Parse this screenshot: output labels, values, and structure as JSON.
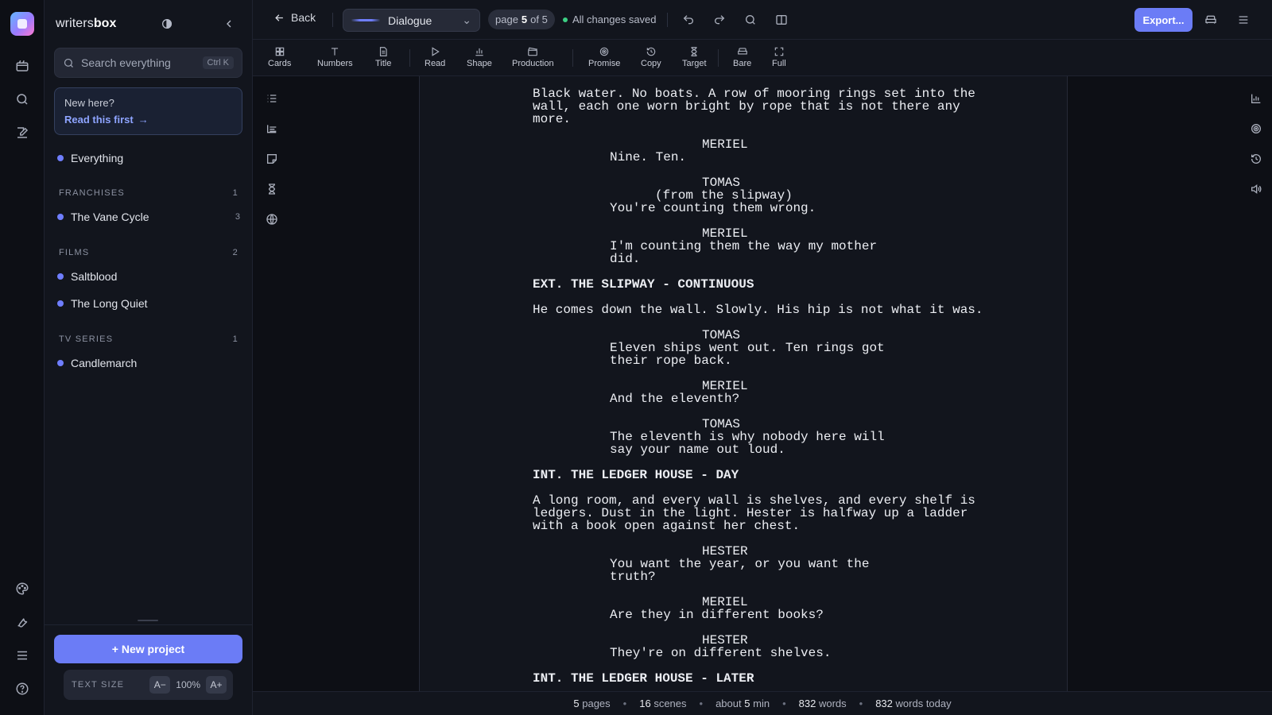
{
  "app": {
    "brand_light": "writers",
    "brand_bold": "box"
  },
  "sidebar": {
    "search_placeholder": "Search everything",
    "search_shortcut": "Ctrl K",
    "newhere_title": "New here?",
    "newhere_link": "Read this first",
    "everything": "Everything",
    "sections": [
      {
        "title": "FRANCHISES",
        "count": "1",
        "items": [
          {
            "label": "The Vane Cycle",
            "count": "3"
          }
        ]
      },
      {
        "title": "FILMS",
        "count": "2",
        "items": [
          {
            "label": "Saltblood"
          },
          {
            "label": "The Long Quiet"
          }
        ]
      },
      {
        "title": "TV SERIES",
        "count": "1",
        "items": [
          {
            "label": "Candlemarch"
          }
        ]
      }
    ],
    "new_project": "+ New project",
    "text_size_label": "TEXT SIZE",
    "text_size_minus": "A−",
    "text_size_value": "100%",
    "text_size_plus": "A+"
  },
  "topbar": {
    "back": "Back",
    "element_type": "Dialogue",
    "page_prefix": "page",
    "page_current": "5",
    "page_suffix": "of 5",
    "saved": "All changes saved",
    "export": "Export..."
  },
  "toolbar": {
    "tools": [
      "Cards",
      "Numbers",
      "Title",
      "Read",
      "Shape",
      "Production",
      "Promise",
      "Copy",
      "Target",
      "Bare",
      "Full"
    ]
  },
  "script": {
    "action1": "Black water. No boats. A row of mooring rings set into the wall, each one worn bright by rope that is not there any more.",
    "c1": "MERIEL",
    "d1": "Nine. Ten.",
    "c2": "TOMAS",
    "p2": "(from the slipway)",
    "d2": "You're counting them wrong.",
    "c3": "MERIEL",
    "d3": "I'm counting them the way my mother did.",
    "slug1": "EXT. THE SLIPWAY - CONTINUOUS",
    "action2": "He comes down the wall. Slowly. His hip is not what it was.",
    "c4": "TOMAS",
    "d4": "Eleven ships went out. Ten rings got their rope back.",
    "c5": "MERIEL",
    "d5": "And the eleventh?",
    "c6": "TOMAS",
    "d6": "The eleventh is why nobody here will say your name out loud.",
    "slug2": "INT. THE LEDGER HOUSE - DAY",
    "action3": "A long room, and every wall is shelves, and every shelf is ledgers. Dust in the light. Hester is halfway up a ladder with a book open against her chest.",
    "c7": "HESTER",
    "d7": "You want the year, or you want the truth?",
    "c8": "MERIEL",
    "d8": "Are they in different books?",
    "c9": "HESTER",
    "d9": "They're on different shelves.",
    "slug3": "INT. THE LEDGER HOUSE - LATER"
  },
  "status": {
    "pages_n": "5",
    "pages_l": "pages",
    "scenes_n": "16",
    "scenes_l": "scenes",
    "time_l": "about",
    "time_n": "5",
    "time_u": "min",
    "words_n": "832",
    "words_l": "words",
    "today_n": "832",
    "today_l": "words today"
  }
}
